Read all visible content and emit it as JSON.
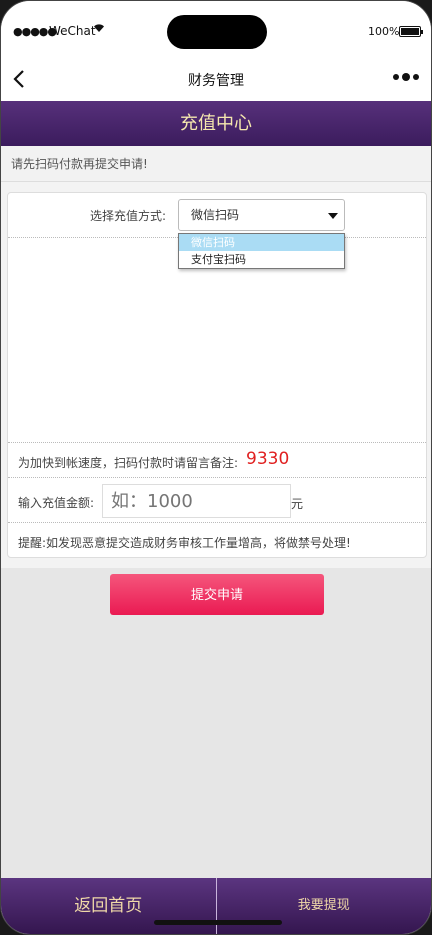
{
  "status": {
    "signal": "●●●●●",
    "carrier": "WeChat",
    "battery_pct": "100%"
  },
  "nav": {
    "title": "财务管理"
  },
  "header": {
    "title": "充值中心"
  },
  "notice": "请先扫码付款再提交申请!",
  "recharge": {
    "method_label": "选择充值方式:",
    "method_selected": "微信扫码",
    "options": [
      "微信扫码",
      "支付宝扫码"
    ],
    "remark_label": "为加快到帐速度，扫码付款时请留言备注:",
    "remark_code": "9330",
    "amount_label": "输入充值金额:",
    "amount_placeholder": "如：1000",
    "amount_unit": "元",
    "warning": "提醒:如发现恶意提交造成财务审核工作量增高，将做禁号处理!"
  },
  "submit_label": "提交申请",
  "footer": {
    "home_label": "返回首页",
    "withdraw_label": "我要提现"
  },
  "colors": {
    "header_purple": "#4a2670",
    "header_text": "#f5e7ae",
    "submit_pink": "#ef2d62",
    "remark_red": "#e02020",
    "option_highlight": "#aadcf4"
  }
}
